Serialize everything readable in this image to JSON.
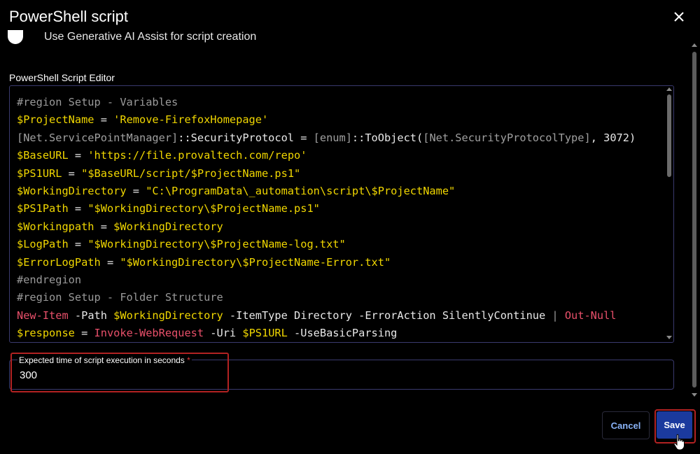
{
  "dialog": {
    "title": "PowerShell script",
    "close_icon": "close-icon"
  },
  "generative_ai": {
    "label": "Use Generative AI Assist for script creation",
    "enabled": false
  },
  "editor": {
    "label": "PowerShell Script Editor",
    "lines": [
      [
        {
          "t": "#region Setup - Variables",
          "c": "comment"
        }
      ],
      [
        {
          "t": "$ProjectName",
          "c": "var"
        },
        {
          "t": " = ",
          "c": "op"
        },
        {
          "t": "'Remove-FirefoxHomepage'",
          "c": "string"
        }
      ],
      [
        {
          "t": "[Net.ServicePointManager]",
          "c": "type"
        },
        {
          "t": "::SecurityProtocol = ",
          "c": "plain"
        },
        {
          "t": "[enum]",
          "c": "type"
        },
        {
          "t": "::ToObject(",
          "c": "plain"
        },
        {
          "t": "[Net.SecurityProtocolType]",
          "c": "type"
        },
        {
          "t": ", 3072)",
          "c": "plain"
        }
      ],
      [
        {
          "t": "$BaseURL",
          "c": "var"
        },
        {
          "t": " = ",
          "c": "op"
        },
        {
          "t": "'https://file.provaltech.com/repo'",
          "c": "string"
        }
      ],
      [
        {
          "t": "$PS1URL",
          "c": "var"
        },
        {
          "t": " = ",
          "c": "op"
        },
        {
          "t": "\"$BaseURL/script/$ProjectName.ps1\"",
          "c": "string"
        }
      ],
      [
        {
          "t": "$WorkingDirectory",
          "c": "var"
        },
        {
          "t": " = ",
          "c": "op"
        },
        {
          "t": "\"C:\\ProgramData\\_automation\\script\\$ProjectName\"",
          "c": "string"
        }
      ],
      [
        {
          "t": "$PS1Path",
          "c": "var"
        },
        {
          "t": " = ",
          "c": "op"
        },
        {
          "t": "\"$WorkingDirectory\\$ProjectName.ps1\"",
          "c": "string"
        }
      ],
      [
        {
          "t": "$Workingpath",
          "c": "var"
        },
        {
          "t": " = ",
          "c": "op"
        },
        {
          "t": "$WorkingDirectory",
          "c": "var"
        }
      ],
      [
        {
          "t": "$LogPath",
          "c": "var"
        },
        {
          "t": " = ",
          "c": "op"
        },
        {
          "t": "\"$WorkingDirectory\\$ProjectName-log.txt\"",
          "c": "string"
        }
      ],
      [
        {
          "t": "$ErrorLogPath",
          "c": "var"
        },
        {
          "t": " = ",
          "c": "op"
        },
        {
          "t": "\"$WorkingDirectory\\$ProjectName-Error.txt\"",
          "c": "string"
        }
      ],
      [
        {
          "t": "#endregion",
          "c": "comment"
        }
      ],
      [
        {
          "t": "#region Setup - Folder Structure",
          "c": "comment"
        }
      ],
      [
        {
          "t": "New-Item",
          "c": "cmd"
        },
        {
          "t": " -Path ",
          "c": "param"
        },
        {
          "t": "$WorkingDirectory",
          "c": "var"
        },
        {
          "t": " -ItemType Directory -ErrorAction SilentlyContinue ",
          "c": "param"
        },
        {
          "t": "|",
          "c": "comment"
        },
        {
          "t": " ",
          "c": "plain"
        },
        {
          "t": "Out-Null",
          "c": "cmd"
        }
      ],
      [
        {
          "t": "$response",
          "c": "var"
        },
        {
          "t": " = ",
          "c": "op"
        },
        {
          "t": "Invoke-WebRequest",
          "c": "cmd"
        },
        {
          "t": " -Uri ",
          "c": "param"
        },
        {
          "t": "$PS1URL",
          "c": "var"
        },
        {
          "t": " -UseBasicParsing",
          "c": "param"
        }
      ]
    ]
  },
  "execution_time": {
    "label": "Expected time of script execution in seconds",
    "required_marker": "*",
    "value": "300"
  },
  "actions": {
    "cancel_label": "Cancel",
    "save_label": "Save"
  },
  "colors": {
    "accent": "#1b3a9e",
    "highlight": "#b22222",
    "variable": "#f1d700",
    "cmdlet": "#e8506a"
  }
}
